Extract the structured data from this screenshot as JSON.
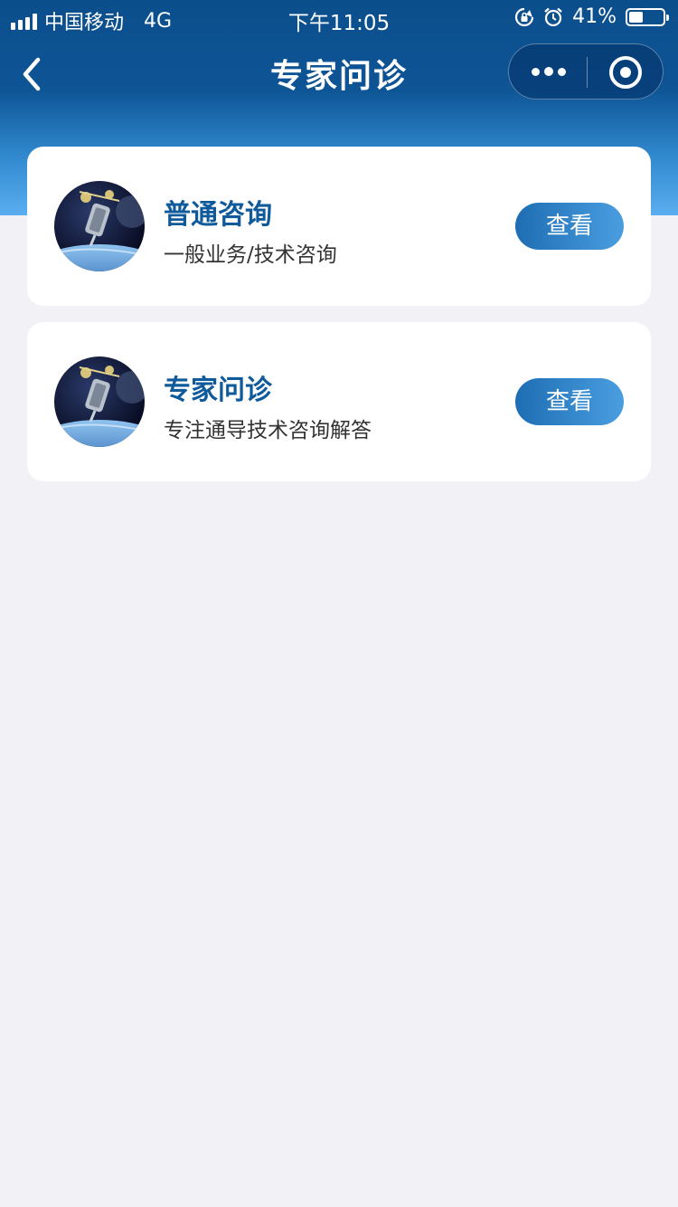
{
  "status_bar": {
    "carrier": "中国移动",
    "network": "4G",
    "time": "下午11:05",
    "battery_percent": "41%",
    "battery_level": 0.41
  },
  "nav": {
    "title": "专家问诊"
  },
  "cards": [
    {
      "title": "普通咨询",
      "description": "一般业务/技术咨询",
      "button_label": "查看"
    },
    {
      "title": "专家问诊",
      "description": "专注通导技术咨询解答",
      "button_label": "查看"
    }
  ],
  "colors": {
    "header": "#0e5596",
    "accent": "#0f5a9b",
    "button": "#2a7cc3",
    "background": "#f2f1f5"
  }
}
